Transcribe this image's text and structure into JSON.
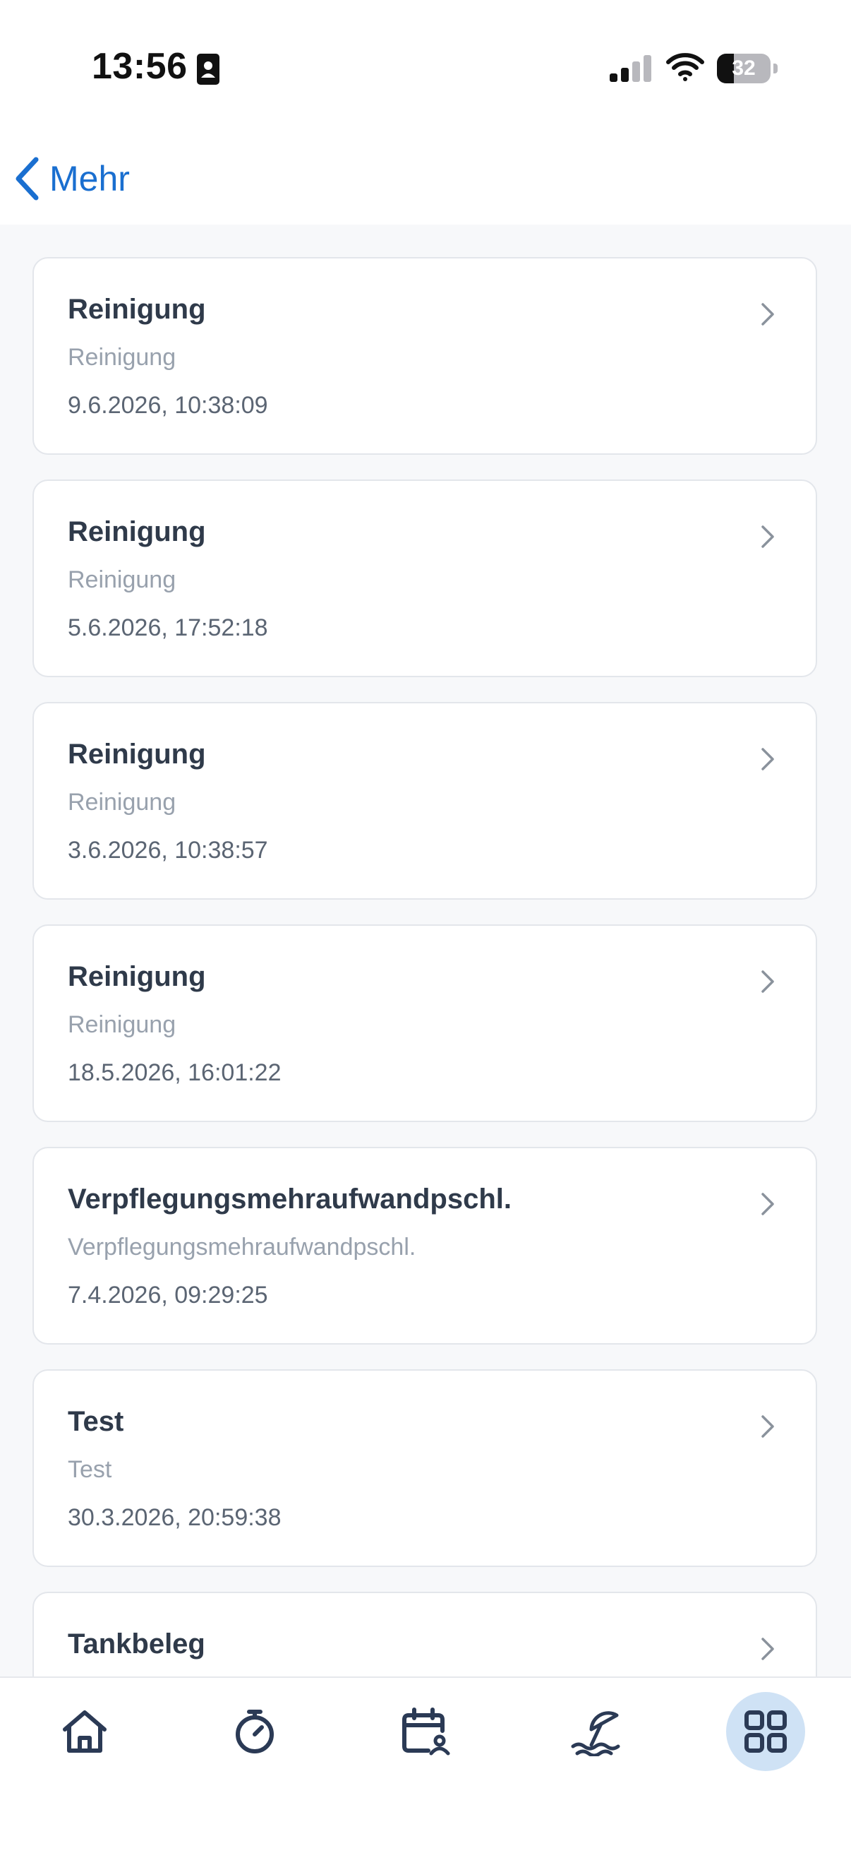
{
  "status_bar": {
    "time": "13:56",
    "battery_level": "32",
    "battery_fraction": 0.32
  },
  "nav": {
    "back_label": "Mehr",
    "accent_color": "#1a6fd0"
  },
  "entries": [
    {
      "title": "Reinigung",
      "subtitle": "Reinigung",
      "date": "9.6.2026, 10:38:09"
    },
    {
      "title": "Reinigung",
      "subtitle": "Reinigung",
      "date": "5.6.2026, 17:52:18"
    },
    {
      "title": "Reinigung",
      "subtitle": "Reinigung",
      "date": "3.6.2026, 10:38:57"
    },
    {
      "title": "Reinigung",
      "subtitle": "Reinigung",
      "date": "18.5.2026, 16:01:22"
    },
    {
      "title": "Verpflegungsmehraufwandpschl.",
      "subtitle": "Verpflegungsmehraufwandpschl.",
      "date": "7.4.2026, 09:29:25"
    },
    {
      "title": "Test",
      "subtitle": "Test",
      "date": "30.3.2026, 20:59:38"
    },
    {
      "title": "Tankbeleg",
      "subtitle": "",
      "date": ""
    }
  ],
  "tab_bar": {
    "tabs": [
      {
        "icon": "home-icon",
        "active": false
      },
      {
        "icon": "stopwatch-icon",
        "active": false
      },
      {
        "icon": "calendar-person-icon",
        "active": false
      },
      {
        "icon": "beach-umbrella-icon",
        "active": false
      },
      {
        "icon": "grid-icon",
        "active": true
      }
    ],
    "active_bg": "#cfe2f5",
    "icon_color": "#2b3a55"
  }
}
